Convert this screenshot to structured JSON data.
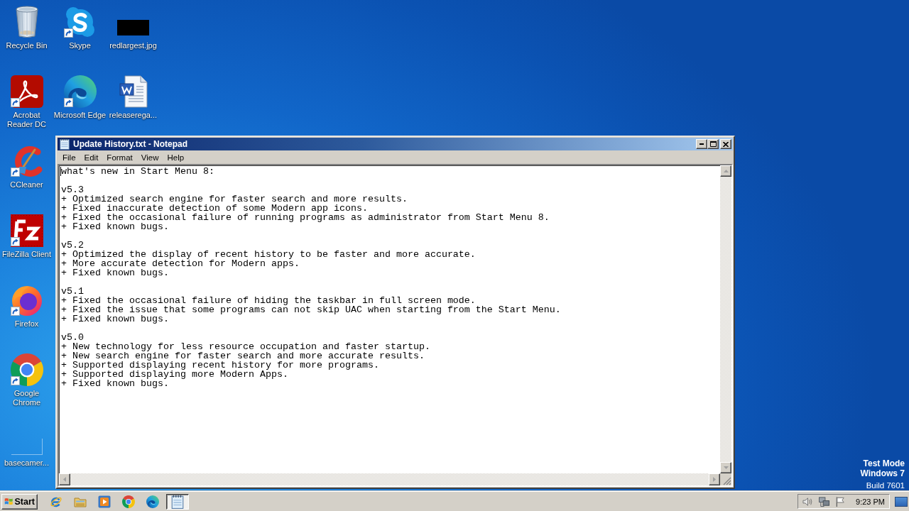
{
  "desktop": {
    "icons": [
      {
        "label": "Recycle Bin",
        "kind": "recycle_bin",
        "shortcut": false
      },
      {
        "label": "Skype",
        "kind": "skype",
        "shortcut": true
      },
      {
        "label": "redlargest.jpg",
        "kind": "image",
        "shortcut": false
      },
      {
        "label": "Acrobat Reader DC",
        "kind": "acrobat",
        "shortcut": true
      },
      {
        "label": "Microsoft Edge",
        "kind": "edge",
        "shortcut": true
      },
      {
        "label": "releaserega...",
        "kind": "word_document",
        "shortcut": false
      },
      {
        "label": "CCleaner",
        "kind": "ccleaner",
        "shortcut": true
      },
      {
        "label": "FileZilla Client",
        "kind": "filezilla",
        "shortcut": true
      },
      {
        "label": "Firefox",
        "kind": "firefox",
        "shortcut": true
      },
      {
        "label": "Google Chrome",
        "kind": "chrome",
        "shortcut": true
      },
      {
        "label": "basecamer...",
        "kind": "blank_image",
        "shortcut": false
      }
    ],
    "system_notice": [
      {
        "text": "Test Mode",
        "bold": true
      },
      {
        "text": "Windows 7",
        "bold": true
      },
      {
        "text": "Build 7601",
        "bold": false
      }
    ]
  },
  "window": {
    "title": "Update History.txt - Notepad",
    "menu": [
      "File",
      "Edit",
      "Format",
      "View",
      "Help"
    ],
    "document": {
      "heading": "what's new in Start Menu 8:",
      "sections": [
        {
          "version": "v5.3",
          "items": [
            "+ Optimized search engine for faster search and more results.",
            "+ Fixed inaccurate detection of some Modern app icons.",
            "+ Fixed the occasional failure of running programs as administrator from Start Menu 8.",
            "+ Fixed known bugs."
          ]
        },
        {
          "version": "v5.2",
          "items": [
            "+ Optimized the display of recent history to be faster and more accurate.",
            "+ More accurate detection for Modern apps.",
            "+ Fixed known bugs."
          ]
        },
        {
          "version": "v5.1",
          "items": [
            "+ Fixed the occasional failure of hiding the taskbar in full screen mode.",
            "+ Fixed the issue that some programs can not skip UAC when starting from the Start Menu.",
            "+ Fixed known bugs."
          ]
        },
        {
          "version": "v5.0",
          "items": [
            "+ New technology for less resource occupation and faster startup.",
            "+ New search engine for faster search and more accurate results.",
            "+ Supported displaying recent history for more programs.",
            "+ Supported displaying more Modern Apps.",
            "+ Fixed known bugs."
          ]
        }
      ]
    }
  },
  "taskbar": {
    "start": "Start",
    "quick_launch": [
      {
        "kind": "internet_explorer"
      },
      {
        "kind": "explorer"
      },
      {
        "kind": "media_player"
      },
      {
        "kind": "chrome"
      },
      {
        "kind": "edge"
      }
    ],
    "window_buttons": [
      {
        "kind": "notepad",
        "selected": true
      }
    ],
    "tray_icons": [
      {
        "kind": "speaker"
      },
      {
        "kind": "network"
      },
      {
        "kind": "flag"
      }
    ],
    "clock": "9:23 PM"
  }
}
